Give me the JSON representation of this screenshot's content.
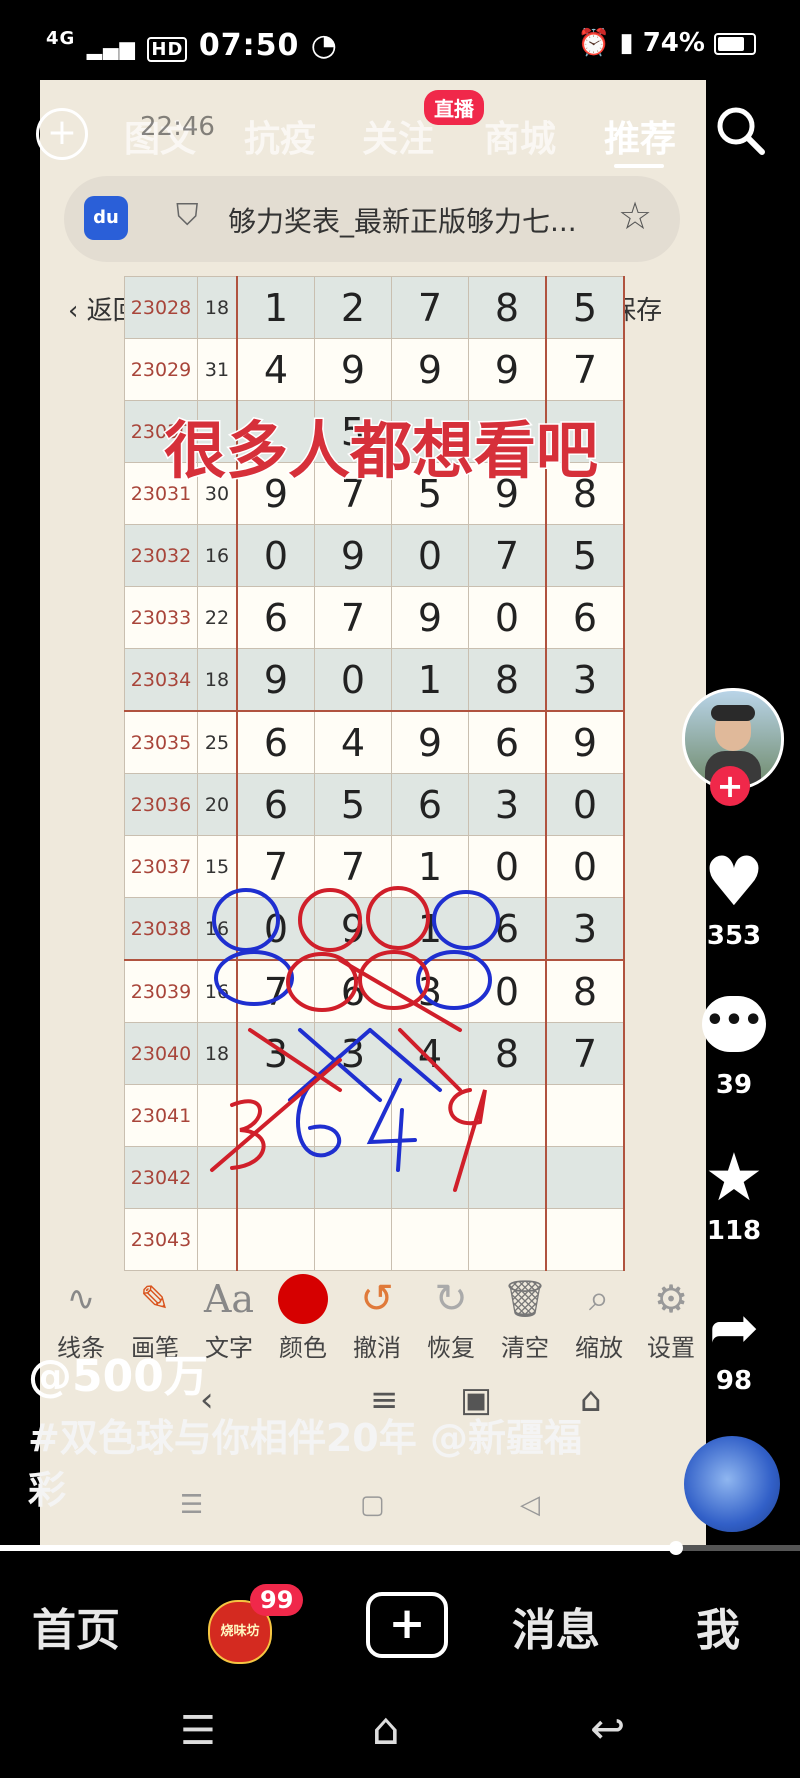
{
  "status_bar": {
    "network": "4G",
    "hd": "HD",
    "time": "07:50",
    "battery": "74%"
  },
  "top_nav": {
    "tabs": [
      "图文",
      "抗疫",
      "关注",
      "商城",
      "推荐"
    ],
    "active_tab": "推荐",
    "live_badge": "直播",
    "inner_clock": "22:46"
  },
  "browser": {
    "title": "够力奖表_最新正版够力七...",
    "back_label": "返回",
    "save_label": "保存"
  },
  "lottery_table": {
    "rows": [
      {
        "issue": "23028",
        "sum": "18",
        "digits": [
          "1",
          "2",
          "7",
          "8",
          "5"
        ]
      },
      {
        "issue": "23029",
        "sum": "31",
        "digits": [
          "4",
          "9",
          "9",
          "9",
          "7"
        ]
      },
      {
        "issue": "23030",
        "sum": "",
        "digits": [
          "",
          "5",
          "",
          "",
          ""
        ]
      },
      {
        "issue": "23031",
        "sum": "30",
        "digits": [
          "9",
          "7",
          "5",
          "9",
          "8"
        ]
      },
      {
        "issue": "23032",
        "sum": "16",
        "digits": [
          "0",
          "9",
          "0",
          "7",
          "5"
        ]
      },
      {
        "issue": "23033",
        "sum": "22",
        "digits": [
          "6",
          "7",
          "9",
          "0",
          "6"
        ]
      },
      {
        "issue": "23034",
        "sum": "18",
        "digits": [
          "9",
          "0",
          "1",
          "8",
          "3"
        ]
      },
      {
        "issue": "23035",
        "sum": "25",
        "digits": [
          "6",
          "4",
          "9",
          "6",
          "9"
        ]
      },
      {
        "issue": "23036",
        "sum": "20",
        "digits": [
          "6",
          "5",
          "6",
          "3",
          "0"
        ]
      },
      {
        "issue": "23037",
        "sum": "15",
        "digits": [
          "7",
          "7",
          "1",
          "0",
          "0"
        ]
      },
      {
        "issue": "23038",
        "sum": "16",
        "digits": [
          "0",
          "9",
          "1",
          "6",
          "3"
        ]
      },
      {
        "issue": "23039",
        "sum": "16",
        "digits": [
          "7",
          "6",
          "3",
          "0",
          "8"
        ]
      },
      {
        "issue": "23040",
        "sum": "18",
        "digits": [
          "3",
          "3",
          "4",
          "8",
          "7"
        ]
      },
      {
        "issue": "23041",
        "sum": "",
        "digits": [
          "",
          "",
          "",
          "",
          ""
        ]
      },
      {
        "issue": "23042",
        "sum": "",
        "digits": [
          "",
          "",
          "",
          "",
          ""
        ]
      },
      {
        "issue": "23043",
        "sum": "",
        "digits": [
          "",
          "",
          "",
          "",
          ""
        ]
      }
    ]
  },
  "overlay_caption": "很多人都想看吧",
  "drawing_toolbar": {
    "tools": [
      "线条",
      "画笔",
      "文字",
      "颜色",
      "撤消",
      "恢复",
      "清空",
      "缩放",
      "设置"
    ]
  },
  "right_rail": {
    "likes": "353",
    "comments": "39",
    "favorites": "118",
    "shares": "98"
  },
  "post": {
    "author": "@500万",
    "description": "#双色球与你相伴20年 @新疆福彩"
  },
  "progress": 0.845,
  "bottom_nav": {
    "home": "首页",
    "badge_count": "99",
    "logo_text": "烧味坊",
    "messages": "消息",
    "me": "我"
  },
  "colors": {
    "live_badge": "#f0284a",
    "follow_plus": "#f0284a",
    "ink_red": "#d01f2a",
    "ink_blue": "#1f2fd0"
  }
}
